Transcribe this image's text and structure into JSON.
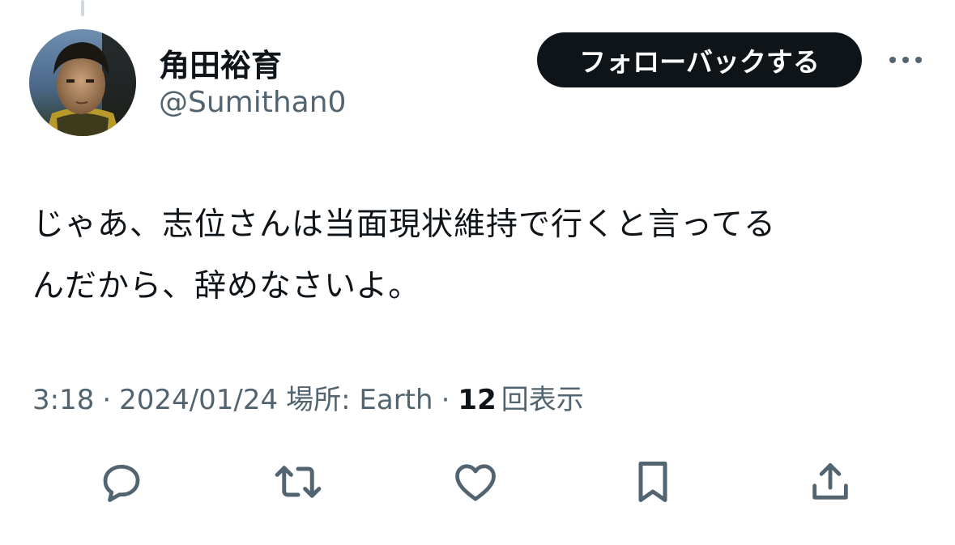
{
  "user": {
    "display_name": "角田裕育",
    "handle": "@Sumithan0"
  },
  "follow_button": {
    "label": "フォローバックする"
  },
  "tweet": {
    "text_lines": [
      "じゃあ、志位さんは当面現状維持で行くと言ってる",
      "んだから、辞めなさいよ。"
    ]
  },
  "meta": {
    "time": "3:18",
    "separator": "·",
    "date": "2024/01/24",
    "location_label": "場所: Earth",
    "views_count": "12",
    "views_label": "回表示"
  },
  "icons": {
    "more": "more-horizontal-icon",
    "reply": "reply-icon",
    "retweet": "retweet-icon",
    "like": "like-icon",
    "bookmark": "bookmark-icon",
    "share": "share-icon"
  },
  "colors": {
    "text_primary": "#0f1419",
    "text_secondary": "#536471",
    "button_bg": "#0f1419",
    "button_text": "#ffffff"
  }
}
